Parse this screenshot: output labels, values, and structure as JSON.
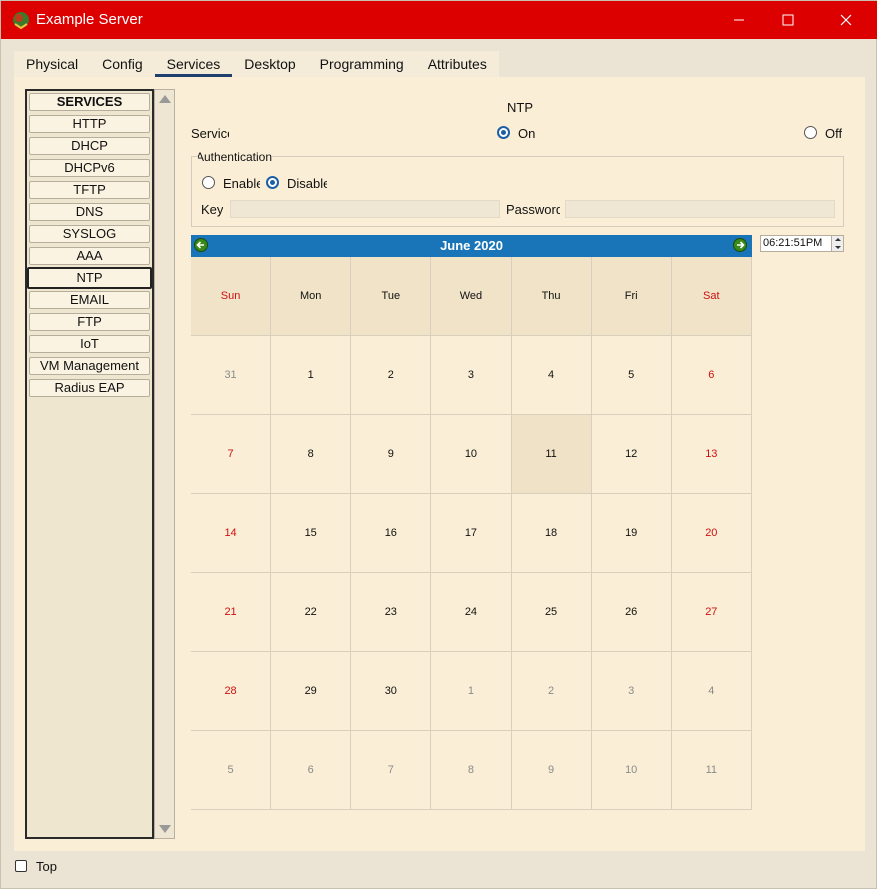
{
  "window": {
    "title": "Example Server",
    "minimize_glyph": "—",
    "maximize_glyph": "☐",
    "close_glyph": "✕"
  },
  "tabs": [
    {
      "label": "Physical"
    },
    {
      "label": "Config"
    },
    {
      "label": "Services"
    },
    {
      "label": "Desktop"
    },
    {
      "label": "Programming"
    },
    {
      "label": "Attributes"
    }
  ],
  "active_tab": "Services",
  "services": {
    "header": "SERVICES",
    "items": [
      "HTTP",
      "DHCP",
      "DHCPv6",
      "TFTP",
      "DNS",
      "SYSLOG",
      "AAA",
      "NTP",
      "EMAIL",
      "FTP",
      "IoT",
      "VM Management",
      "Radius EAP"
    ],
    "selected": "NTP"
  },
  "ntp": {
    "title": "NTP",
    "service_label": "Service",
    "on_label": "On",
    "off_label": "Off",
    "service_state": "On",
    "auth_legend": "Authentication",
    "enable_label": "Enable",
    "disable_label": "Disable",
    "auth_state": "Disable",
    "key_label": "Key",
    "key_value": "",
    "password_label": "Password",
    "password_value": ""
  },
  "calendar": {
    "month_year": "June  2020",
    "days_of_week": [
      "Sun",
      "Mon",
      "Tue",
      "Wed",
      "Thu",
      "Fri",
      "Sat"
    ],
    "weeks": [
      [
        "31",
        "1",
        "2",
        "3",
        "4",
        "5",
        "6"
      ],
      [
        "7",
        "8",
        "9",
        "10",
        "11",
        "12",
        "13"
      ],
      [
        "14",
        "15",
        "16",
        "17",
        "18",
        "19",
        "20"
      ],
      [
        "21",
        "22",
        "23",
        "24",
        "25",
        "26",
        "27"
      ],
      [
        "28",
        "29",
        "30",
        "1",
        "2",
        "3",
        "4"
      ],
      [
        "5",
        "6",
        "7",
        "8",
        "9",
        "10",
        "11"
      ]
    ],
    "selected_day": "11",
    "weekend_color": "#cc1111",
    "header_color": "#1a75b8"
  },
  "time": {
    "value": "06:21:51PM"
  },
  "footer": {
    "top_label": "Top",
    "top_checked": false
  },
  "colors": {
    "titlebar": "#dd0000",
    "content_bg": "#fbeed6",
    "radio_accent": "#1b5fa6"
  }
}
